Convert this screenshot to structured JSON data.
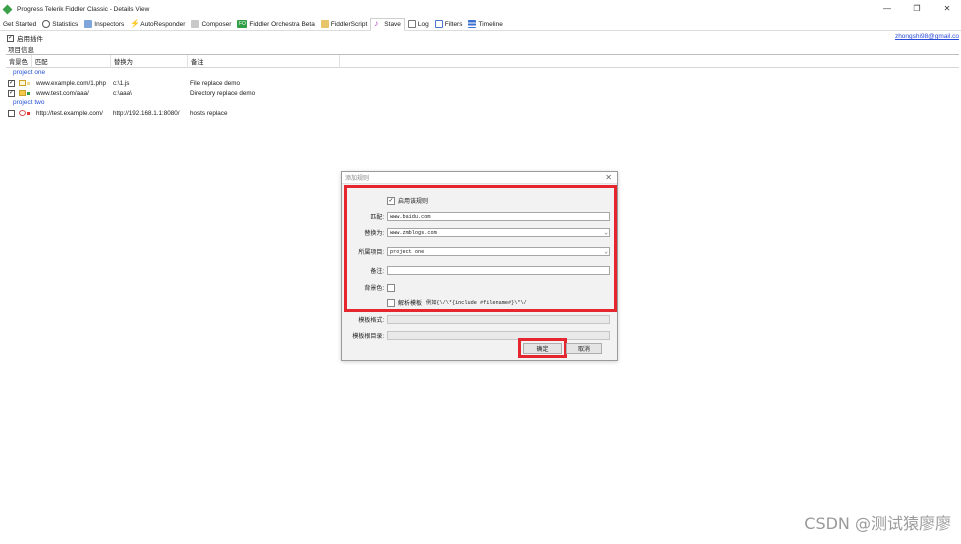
{
  "window": {
    "title": "Progress Telerik Fiddler Classic - Details View",
    "controls": {
      "minimize": "—",
      "restore": "❐",
      "close": "✕"
    }
  },
  "tabs": [
    {
      "label": "Get Started",
      "icon": ""
    },
    {
      "label": "Statistics",
      "icon": "stopwatch-icon"
    },
    {
      "label": "Inspectors",
      "icon": "inspectors-icon"
    },
    {
      "label": "AutoResponder",
      "icon": "lightning-icon"
    },
    {
      "label": "Composer",
      "icon": "composer-icon"
    },
    {
      "label": "Fiddler Orchestra Beta",
      "icon": "fo-icon",
      "icon_text": "FO"
    },
    {
      "label": "FiddlerScript",
      "icon": "script-icon"
    },
    {
      "label": "Stave",
      "icon": "music-note-icon",
      "active": true
    },
    {
      "label": "Log",
      "icon": "log-icon"
    },
    {
      "label": "Filters",
      "icon": "filter-icon"
    },
    {
      "label": "Timeline",
      "icon": "timeline-icon"
    }
  ],
  "toolbar": {
    "enable_plugin_label": "启用插件",
    "enable_checked": "✓",
    "user_link": "zhongshi98@gmail.co"
  },
  "project_info_label": "项目信息",
  "grid": {
    "headers": [
      "背景色",
      "匹配",
      "替换为",
      "备注"
    ],
    "groups": [
      {
        "name": "project one",
        "rows": [
          {
            "checked": true,
            "icon": "file-icon",
            "color": "#e8d88a",
            "match": "www.example.com/1.php",
            "replace": "c:\\1.js",
            "note": "File replace demo"
          },
          {
            "checked": true,
            "icon": "folder-icon",
            "color": "#2f9e44",
            "match": "www.test.com/aaa/",
            "replace": "c:\\aaa\\",
            "note": "Directory replace demo"
          }
        ]
      },
      {
        "name": "project two",
        "rows": [
          {
            "checked": false,
            "icon": "hosts-icon",
            "color": "#e53935",
            "match": "http://test.example.com/",
            "replace": "http://192.168.1.1:8080/",
            "note": "hosts replace"
          }
        ]
      }
    ]
  },
  "dialog": {
    "title": "添加规则",
    "close": "✕",
    "enable_rule_label": "启用该规则",
    "enable_rule_checked": "✓",
    "match_label": "匹配:",
    "match_value": "www.baidu.com",
    "replace_label": "替换为:",
    "replace_value": "www.zmblogs.com",
    "project_label": "所属项目:",
    "project_value": "project one",
    "note_label": "备注:",
    "note_value": "",
    "bg_label": "背景色:",
    "template_checkbox_label": "解析模板",
    "template_hint": "例如{\\/\\*{include #filename#}\\*\\/",
    "template_format_label": "模板格式:",
    "template_root_label": "模板根目录:",
    "ok_label": "确定",
    "cancel_label": "取消",
    "highlight_color": "#e5262e"
  },
  "watermark": "CSDN @测试猿廖廖"
}
